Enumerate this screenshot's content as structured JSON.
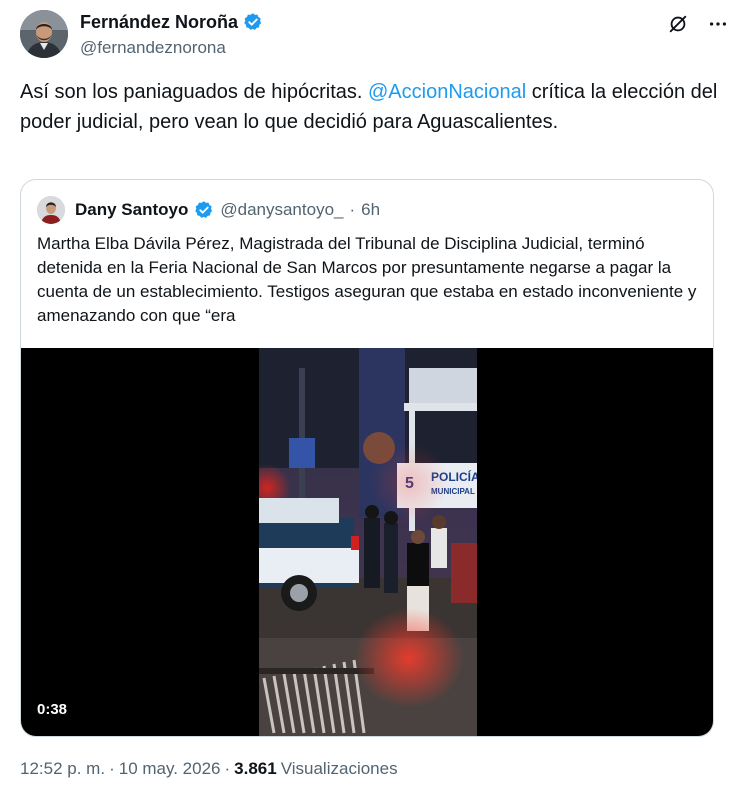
{
  "author": {
    "name": "Fernández Noroña",
    "handle": "@fernandeznorona"
  },
  "tweet": {
    "text_before": "Así son los paniaguados de hipócritas. ",
    "mention": "@AccionNacional",
    "text_after": " crítica la elección del poder judicial, pero vean lo que decidió para Aguascalientes."
  },
  "quoted": {
    "name": "Dany Santoyo",
    "handle": "@danysantoyo_",
    "separator": "·",
    "time": "6h",
    "text": "Martha Elba Dávila Pérez, Magistrada del Tribunal de Disciplina Judicial, terminó detenida en la Feria Nacional de San Marcos por presuntamente negarse a pagar la cuenta de un establecimiento. Testigos aseguran que estaba en estado inconveniente y amenazando con que “era",
    "video": {
      "duration": "0:38",
      "sign_line1": "POLICÍA",
      "sign_line2": "MUNICIPAL",
      "sign_number": "5"
    }
  },
  "footer": {
    "time": "12:52 p. m.",
    "sep1": "·",
    "date": "10 may. 2026",
    "sep2": "·",
    "views_count": "3.861",
    "views_label": "Visualizaciones"
  },
  "icons": {
    "verified": "verified-badge-icon",
    "grok": "grok-icon",
    "more": "more-icon"
  },
  "colors": {
    "accent": "#1d9bf0",
    "secondary_text": "#536471",
    "border": "#cfd9de"
  }
}
